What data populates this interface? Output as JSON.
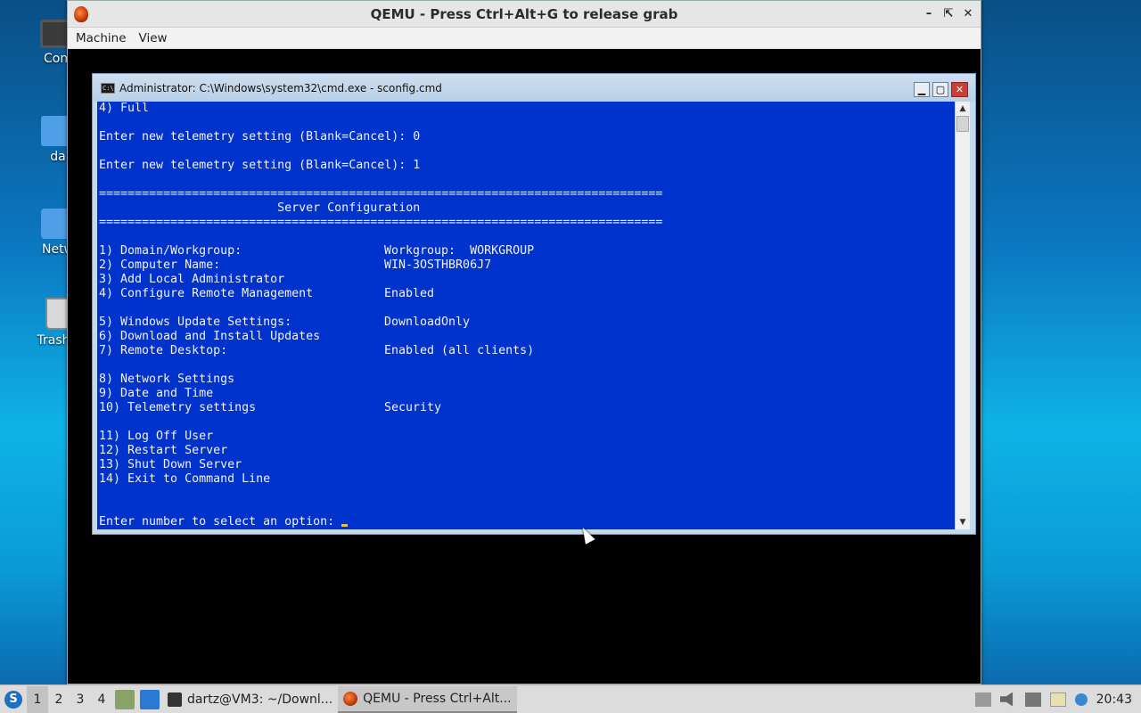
{
  "desktop": {
    "icons": [
      {
        "label": "Com"
      },
      {
        "label": "da"
      },
      {
        "label": "Netw"
      },
      {
        "label": "Trash ("
      }
    ]
  },
  "qemu": {
    "title": "QEMU - Press Ctrl+Alt+G to release grab",
    "menu": [
      "Machine",
      "View"
    ]
  },
  "cmd": {
    "title": "Administrator: C:\\Windows\\system32\\cmd.exe - sconfig.cmd",
    "lines_top": [
      "4) Full",
      "",
      "Enter new telemetry setting (Blank=Cancel): 0",
      "",
      "Enter new telemetry setting (Blank=Cancel): 1",
      ""
    ],
    "separator": "===============================================================================",
    "header": "                         Server Configuration",
    "options": [
      {
        "label": "1) Domain/Workgroup:",
        "value": "Workgroup:  WORKGROUP"
      },
      {
        "label": "2) Computer Name:",
        "value": "WIN-3OSTHBR06J7"
      },
      {
        "label": "3) Add Local Administrator",
        "value": ""
      },
      {
        "label": "4) Configure Remote Management",
        "value": "Enabled"
      },
      {
        "label": "",
        "value": ""
      },
      {
        "label": "5) Windows Update Settings:",
        "value": "DownloadOnly"
      },
      {
        "label": "6) Download and Install Updates",
        "value": ""
      },
      {
        "label": "7) Remote Desktop:",
        "value": "Enabled (all clients)"
      },
      {
        "label": "",
        "value": ""
      },
      {
        "label": "8) Network Settings",
        "value": ""
      },
      {
        "label": "9) Date and Time",
        "value": ""
      },
      {
        "label": "10) Telemetry settings",
        "value": "Security"
      },
      {
        "label": "",
        "value": ""
      },
      {
        "label": "11) Log Off User",
        "value": ""
      },
      {
        "label": "12) Restart Server",
        "value": ""
      },
      {
        "label": "13) Shut Down Server",
        "value": ""
      },
      {
        "label": "14) Exit to Command Line",
        "value": ""
      },
      {
        "label": "",
        "value": ""
      },
      {
        "label": "",
        "value": ""
      }
    ],
    "prompt": "Enter number to select an option: "
  },
  "taskbar": {
    "workspaces": [
      "1",
      "2",
      "3",
      "4"
    ],
    "tasks": [
      {
        "label": "dartz@VM3: ~/Downl..."
      },
      {
        "label": "QEMU - Press Ctrl+Alt..."
      }
    ],
    "clock": "20:43"
  },
  "colors": {
    "console_bg": "#0033cc",
    "console_fg": "#f0f0f0",
    "cursor": "#f0c23a"
  }
}
